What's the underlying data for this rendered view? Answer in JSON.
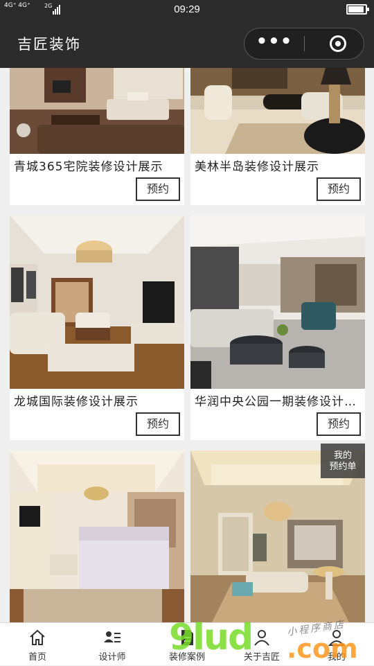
{
  "status_bar": {
    "network": "4G⁺ 4G⁺",
    "network2": "2G",
    "time": "09:29",
    "battery_level": 0.9
  },
  "nav": {
    "title": "吉匠装饰",
    "more_icon": "ellipsis-icon",
    "close_icon": "target-close-icon"
  },
  "cases": [
    {
      "title": "青城365宅院装修设计展示",
      "button": "预约"
    },
    {
      "title": "美林半岛装修设计展示",
      "button": "预约"
    },
    {
      "title": "龙城国际装修设计展示",
      "button": "预约"
    },
    {
      "title": "华润中央公园一期装修设计展示",
      "button": "预约"
    },
    {
      "title": "",
      "button": ""
    },
    {
      "title": "",
      "button": ""
    }
  ],
  "floating": {
    "line1": "我的",
    "line2": "预约单"
  },
  "tabbar": {
    "items": [
      {
        "label": "首页",
        "icon": "home-icon"
      },
      {
        "label": "设计师",
        "icon": "designer-list-icon"
      },
      {
        "label": "装修案例",
        "icon": "document-icon"
      },
      {
        "label": "关于吉匠",
        "icon": "person-icon"
      },
      {
        "label": "我的",
        "icon": "user-icon"
      }
    ]
  },
  "watermark": {
    "brand": "9lud",
    "domain": ".com",
    "tagline": "小程序商店"
  }
}
